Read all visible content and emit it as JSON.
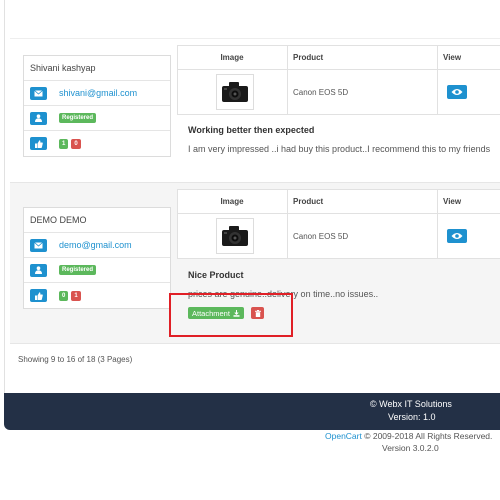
{
  "reviews": [
    {
      "user_name": "Shivani kashyap",
      "email": "shivani@gmail.com",
      "status_badge": "Registered",
      "likes": "1",
      "dislikes": "0",
      "table": {
        "headers": [
          "Image",
          "Product",
          "View"
        ],
        "product": "Canon EOS 5D"
      },
      "title": "Working better then expected",
      "text": "I am very impressed ..i had buy this product..I recommend this to my friends"
    },
    {
      "user_name": "DEMO DEMO",
      "email": "demo@gmail.com",
      "status_badge": "Registered",
      "likes": "0",
      "dislikes": "1",
      "table": {
        "headers": [
          "Image",
          "Product",
          "View"
        ],
        "product": "Canon EOS 5D"
      },
      "title": "Nice Product",
      "text": "prices are genuine..delivery on time..no issues..",
      "attachment_label": "Attachment"
    }
  ],
  "pagination": "Showing 9 to 16 of 18 (3 Pages)",
  "footer": {
    "copyright": "© Webx IT Solutions",
    "version": "Version: 1.0"
  },
  "opencart": {
    "link": "OpenCart",
    "rest": " © 2009-2018 All Rights Reserved.",
    "version": "Version 3.0.2.0"
  },
  "colors": {
    "primary": "#1e91cf",
    "success": "#5cb85c",
    "danger": "#d9534f",
    "footer_bg": "#233046",
    "highlight": "#e01f26"
  },
  "icons": [
    "envelope-icon",
    "user-icon",
    "thumbs-up-icon",
    "eye-icon",
    "download-icon",
    "trash-icon",
    "camera-icon"
  ]
}
